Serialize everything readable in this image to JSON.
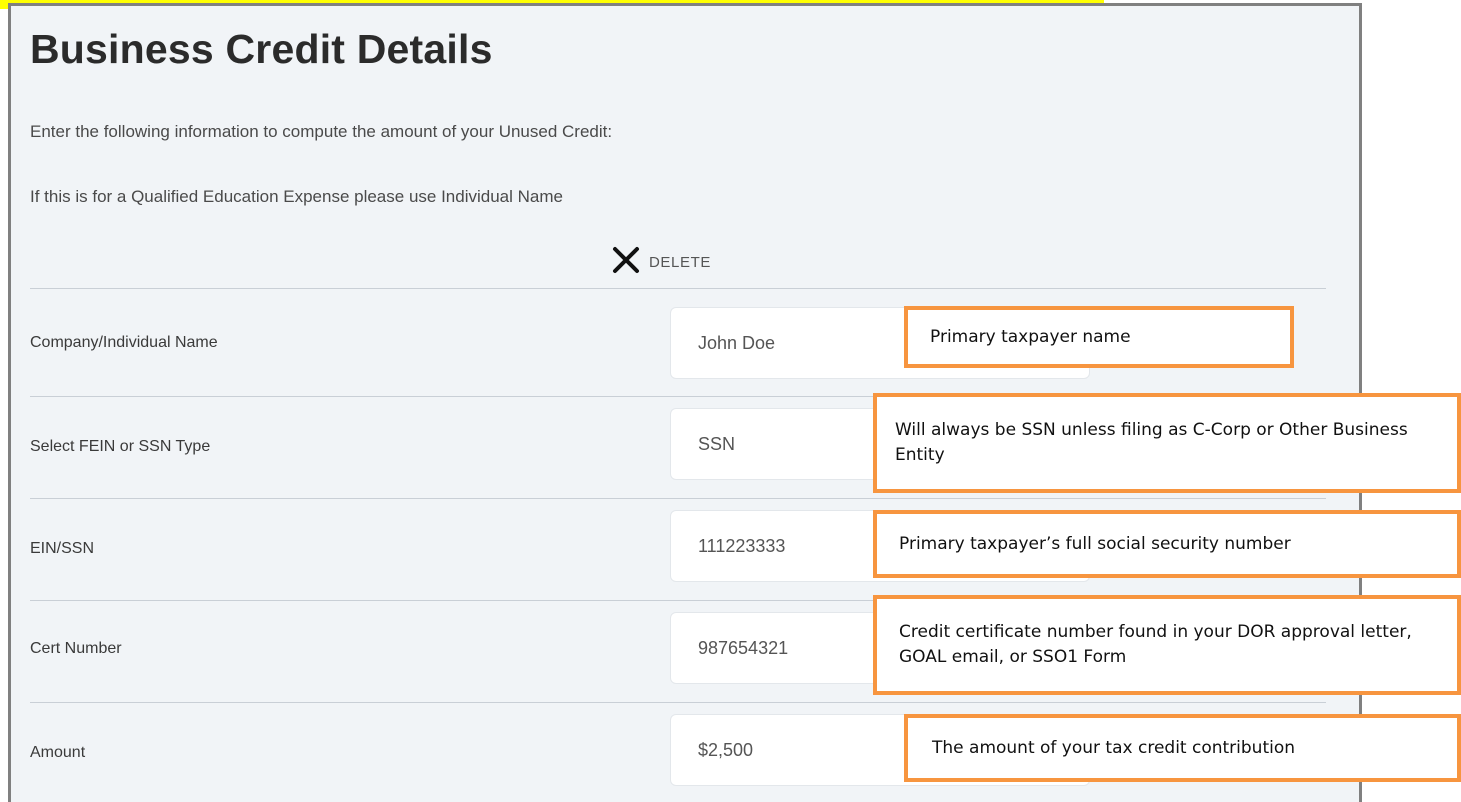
{
  "page": {
    "title": "Business Credit Details",
    "intro_line1": "Enter the following information to compute the amount of your Unused Credit:",
    "intro_line2": "If this is for a Qualified Education Expense please use Individual Name",
    "delete_label": "DELETE"
  },
  "colors": {
    "panel_bg": "#f1f4f7",
    "callout_border": "#f7953f",
    "highlight": "#ffff00"
  },
  "rows": [
    {
      "label": "Company/Individual Name",
      "value": "John Doe"
    },
    {
      "label": "Select FEIN or SSN Type",
      "value": "SSN"
    },
    {
      "label": "EIN/SSN",
      "value": "111223333"
    },
    {
      "label": "Cert Number",
      "value": "987654321"
    },
    {
      "label": "Amount",
      "value": "$2,500"
    }
  ],
  "callouts": [
    {
      "text": "Primary taxpayer name"
    },
    {
      "text": "Will always be SSN unless filing as C-Corp or Other Business Entity"
    },
    {
      "text": "Primary taxpayer’s full social security number"
    },
    {
      "text": "Credit certificate number found in your DOR approval letter, GOAL email, or SSO1 Form"
    },
    {
      "text": "The amount of your tax credit contribution"
    }
  ]
}
